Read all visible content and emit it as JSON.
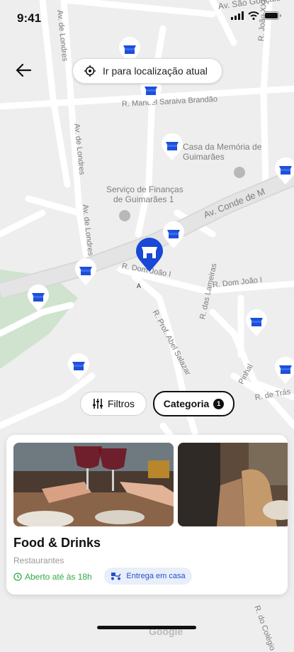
{
  "status_bar": {
    "time": "9:41"
  },
  "header": {
    "locate_label": "Ir para localização atual"
  },
  "map": {
    "streets": {
      "av_sao_goncalo": "Av. São Gonçalo",
      "av_londres_1": "Av. de Londres",
      "av_londres_2": "Av. de Londres",
      "av_londres_3": "Av. de Londres",
      "r_manuel": "R. Manuel Saraiva Brandão",
      "r_joao_xxi": "R. João XXI",
      "av_conde": "Av. Conde de M",
      "r_dom_joao_1": "R. Dom João I",
      "r_dom_joao_2": "R. Dom João I",
      "r_prof_abel": "R. Prof. Abel Salazar",
      "r_lameiras": "R. das Lameiras",
      "r_tras": "R. de Trás",
      "r_pinhal": "Pinhal",
      "r_colegio": "R. do Colégio"
    },
    "poi": {
      "memoria": "Casa da Memória de Guimarães",
      "financas_1": "Serviço de Finanças",
      "financas_2": "de Guimarães 1",
      "marker_a": "A"
    },
    "watermark": "Google",
    "colors": {
      "pin": "#1d4fd8",
      "pin_main": "#1947d6",
      "park": "#cfe3cf",
      "road": "#ffffff"
    }
  },
  "filters": {
    "filters_label": "Filtros",
    "category_label": "Categoria",
    "category_count": "1"
  },
  "card": {
    "title": "Food & Drinks",
    "category": "Restaurantes",
    "status": "Aberto até às 18h",
    "delivery": "Entrega em casa",
    "status_color": "#33a844"
  }
}
